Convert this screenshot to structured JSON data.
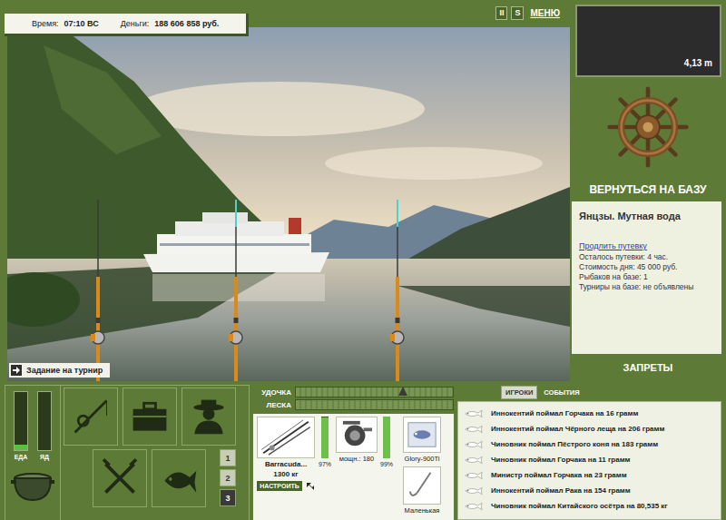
{
  "status": {
    "time_label": "Время:",
    "time": "07:10 ВС",
    "money_label": "Деньги:",
    "money": "188 606 858 руб."
  },
  "top_buttons": [
    {
      "label": "II"
    },
    {
      "label": "S"
    },
    {
      "label": "МЕНЮ"
    }
  ],
  "depth": "4,13 m",
  "tournament_task": {
    "label": "Задание на турнир"
  },
  "base": {
    "return_label": "ВЕРНУТЬСЯ НА БАЗУ",
    "location": "Янцзы. Мутная вода",
    "extend_link": "Продлить путевку",
    "details": [
      "Осталось путевки: 4 час.",
      "Стоимость дня: 45 000 руб.",
      "Рыбаков на базе: 1",
      "Турниры на базе: не объявлены"
    ],
    "bans_label": "ЗАПРЕТЫ"
  },
  "meters": [
    {
      "label": "ЕДА",
      "level": 0.1
    },
    {
      "label": "ЯД",
      "level": 0
    }
  ],
  "slots": [
    {
      "label": "1",
      "selected": false
    },
    {
      "label": "2",
      "selected": false
    },
    {
      "label": "3",
      "selected": true
    }
  ],
  "tension": [
    {
      "label": "УДОЧКА",
      "kind": "marker",
      "level": 0.68
    },
    {
      "label": "ЛЕСКА",
      "kind": "bar",
      "level": 0
    }
  ],
  "gear": {
    "rod": {
      "name": "Barracuda...",
      "capacity": "1300 кг",
      "wear": "97%",
      "level": 0.97,
      "button": "НАСТРОИТЬ"
    },
    "reel": {
      "power": "мощн.: 180",
      "wear": "99%",
      "level": 0.99
    },
    "lure": {
      "name": "Glory-900Ti"
    },
    "hook": {
      "name": "Маленькая"
    }
  },
  "log": {
    "tabs": [
      {
        "label": "ИГРОКИ",
        "selected": true
      },
      {
        "label": "СОБЫТИЯ",
        "selected": false
      }
    ],
    "entries": [
      "Иннокентий поймал Горчака на 16 грамм",
      "Иннокентий поймал Чёрного леща на 206 грамм",
      "Чиновник поймал Пёстрого коня на 183 грамм",
      "Чиновник поймал Горчака на 11 грамм",
      "Министр поймал Горчака на 23 грамм",
      "Иннокентий поймал Рака на 154 грамм",
      "Чиновник поймал Китайского осётра на 80,535 кг"
    ]
  }
}
